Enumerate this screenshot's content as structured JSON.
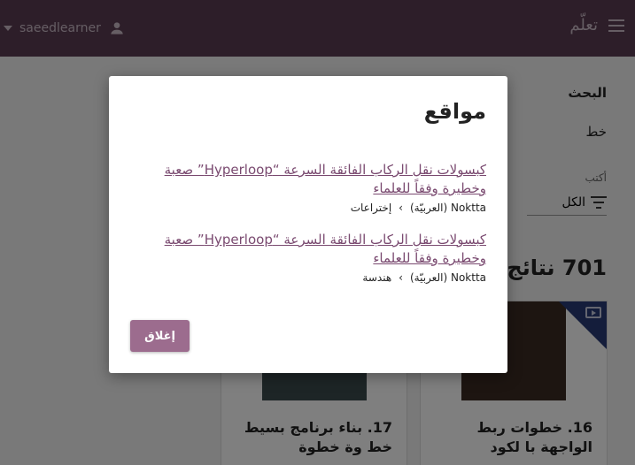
{
  "header": {
    "app_title": "تعلّم",
    "username": "saeedlearner"
  },
  "sidebar": {
    "search_heading": "البحث",
    "line_label": "خط",
    "filter_caption": "أكتب",
    "filter_value": "الكل"
  },
  "results": {
    "count_title": "701 نتائج ت"
  },
  "cards": [
    {
      "title": "16. خطوات ربط الواجهة با لكود"
    },
    {
      "title": "17. بناء برنامج بسيط خط وة خطوة"
    }
  ],
  "modal": {
    "title": "مواقع",
    "sites": [
      {
        "link": "كبسولات نقل الركاب الفائقة السرعة “Hyperloop” صعبة وخطيرة وفقاً للعلماء",
        "source": "Noktta (العربيّة)",
        "separator": "›",
        "category": "إختراعات"
      },
      {
        "link": "كبسولات نقل الركاب الفائقة السرعة “Hyperloop” صعبة وخطيرة وفقاً للعلماء",
        "source": "Noktta (العربيّة)",
        "separator": "›",
        "category": "هندسة"
      }
    ],
    "close_label": "إغلاق"
  }
}
